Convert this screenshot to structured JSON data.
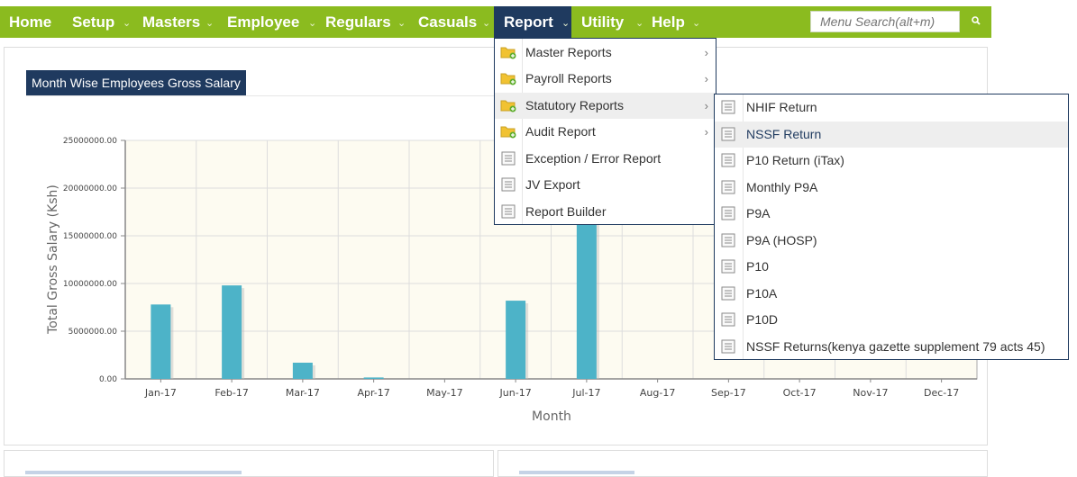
{
  "nav": {
    "items": [
      {
        "label": "Home",
        "has_caret": false
      },
      {
        "label": "Setup",
        "has_caret": true
      },
      {
        "label": "Masters",
        "has_caret": true
      },
      {
        "label": "Employee",
        "has_caret": true
      },
      {
        "label": "Regulars",
        "has_caret": true
      },
      {
        "label": "Casuals",
        "has_caret": true
      },
      {
        "label": "Report",
        "has_caret": true,
        "active": true
      },
      {
        "label": "Utility",
        "has_caret": true
      },
      {
        "label": "Help",
        "has_caret": true
      }
    ],
    "search_placeholder": "Menu Search(alt+m)",
    "search_icon": "search-icon",
    "colors": {
      "bar": "#8bbb1f",
      "active": "#1f3a5f"
    }
  },
  "panel": {
    "title": "Month Wise Employees Gross Salary"
  },
  "report_menu": {
    "items": [
      {
        "label": "Master Reports",
        "icon": "folder-add-icon",
        "submenu": true
      },
      {
        "label": "Payroll Reports",
        "icon": "folder-add-icon",
        "submenu": true
      },
      {
        "label": "Statutory Reports",
        "icon": "folder-add-icon",
        "submenu": true,
        "highlighted": true
      },
      {
        "label": "Audit Report",
        "icon": "folder-add-icon",
        "submenu": true
      },
      {
        "label": "Exception / Error Report",
        "icon": "document-icon",
        "submenu": false
      },
      {
        "label": "JV Export",
        "icon": "document-icon",
        "submenu": false
      },
      {
        "label": "Report Builder",
        "icon": "document-icon",
        "submenu": false
      }
    ]
  },
  "statutory_menu": {
    "items": [
      {
        "label": "NHIF Return",
        "icon": "document-icon"
      },
      {
        "label": "NSSF Return",
        "icon": "document-icon",
        "highlighted": true
      },
      {
        "label": "P10 Return (iTax)",
        "icon": "document-icon"
      },
      {
        "label": "Monthly P9A",
        "icon": "document-icon"
      },
      {
        "label": "P9A",
        "icon": "document-icon"
      },
      {
        "label": "P9A (HOSP)",
        "icon": "document-icon"
      },
      {
        "label": "P10",
        "icon": "document-icon"
      },
      {
        "label": "P10A",
        "icon": "document-icon"
      },
      {
        "label": "P10D",
        "icon": "document-icon"
      },
      {
        "label": "NSSF Returns(kenya gazette supplement 79 acts 45)",
        "icon": "document-icon"
      }
    ]
  },
  "chart_data": {
    "type": "bar",
    "xlabel": "Month",
    "ylabel": "Total Gross Salary  (Ksh)",
    "ylim": [
      0,
      25000000
    ],
    "yticks": [
      "0.00",
      "5000000.00",
      "10000000.00",
      "15000000.00",
      "20000000.00",
      "25000000.00"
    ],
    "categories": [
      "Jan-17",
      "Feb-17",
      "Mar-17",
      "Apr-17",
      "May-17",
      "Jun-17",
      "Jul-17",
      "Aug-17",
      "Sep-17",
      "Oct-17",
      "Nov-17",
      "Dec-17"
    ],
    "values": [
      7800000,
      9800000,
      1700000,
      150000,
      0,
      8200000,
      17000000,
      0,
      0,
      0,
      0,
      0
    ],
    "grid": true,
    "colors": {
      "bar": "#4db3c8",
      "plot_bg": "#fdfbf1",
      "grid": "#dddddd"
    }
  }
}
